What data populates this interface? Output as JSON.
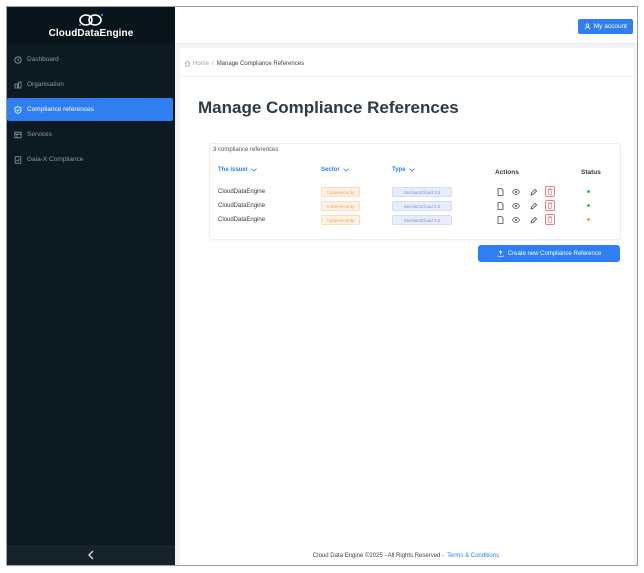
{
  "app": {
    "brand": "CloudDataEngine",
    "accent_color": "#2f7ff2",
    "sidebar_bg": "#0e1a22"
  },
  "sidebar": {
    "items": [
      {
        "label": "Dashboard",
        "icon": "clock-icon",
        "active": false
      },
      {
        "label": "Organisation",
        "icon": "organisation-icon",
        "active": false
      },
      {
        "label": "Compliance references",
        "icon": "shield-check-icon",
        "active": true
      },
      {
        "label": "Services",
        "icon": "services-icon",
        "active": false
      },
      {
        "label": "Gaia-X Compliance",
        "icon": "document-check-icon",
        "active": false
      }
    ],
    "collapse_icon": "chevron-left-icon"
  },
  "topbar": {
    "account_label": "My account",
    "account_icon": "user-icon"
  },
  "breadcrumb": {
    "home": "Home",
    "separator": "/",
    "current": "Manage Compliance References"
  },
  "page": {
    "title": "Manage Compliance References"
  },
  "table": {
    "count_text": "3 compliance references",
    "headers": {
      "issuer": "The issuer",
      "sector": "Sector",
      "type": "Type",
      "actions": "Actions",
      "status": "Status"
    },
    "rows": [
      {
        "issuer": "CloudDataEngine",
        "sector": "Cybersecurity",
        "type": "SecNumCloud 3.2",
        "status_color": "#3cc04b"
      },
      {
        "issuer": "CloudDataEngine",
        "sector": "Cybersecurity",
        "type": "SecNumCloud 3.2",
        "status_color": "#3cc04b"
      },
      {
        "issuer": "CloudDataEngine",
        "sector": "Cybersecurity",
        "type": "SecNumCloud 3.2",
        "status_color": "#f0a23a"
      }
    ],
    "action_icons": [
      "document-icon",
      "eye-icon",
      "pencil-icon",
      "trash-icon"
    ]
  },
  "create_button": {
    "label": "Create new Compliance Reference",
    "icon": "upload-icon"
  },
  "footer": {
    "text": "Cloud Data Engine ©2025 - All Rights Reserved -",
    "link": "Terms & Conditions"
  }
}
